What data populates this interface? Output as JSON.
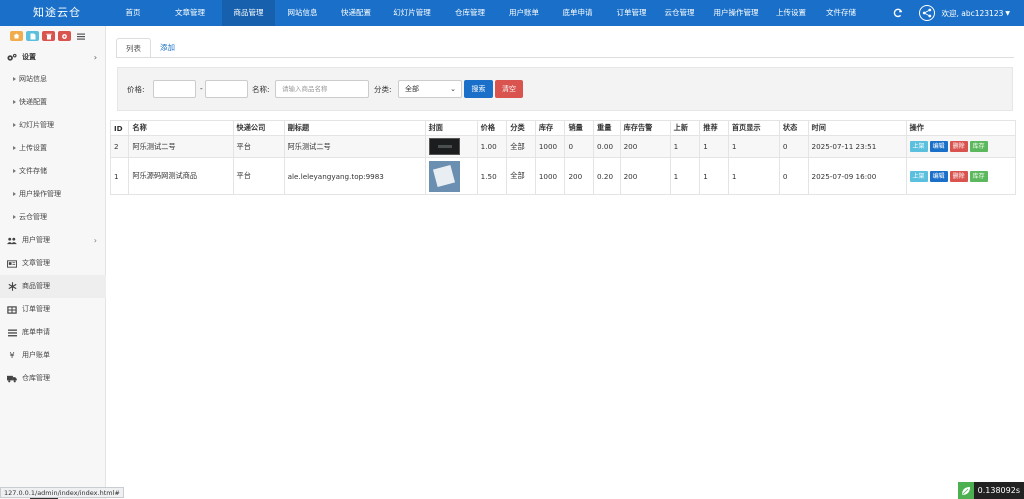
{
  "app": {
    "brand": "知途云仓"
  },
  "nav": {
    "items": [
      {
        "label": "首页"
      },
      {
        "label": "文章管理"
      },
      {
        "label": "商品管理"
      },
      {
        "label": "网站信息"
      },
      {
        "label": "快递配置"
      },
      {
        "label": "幻灯片管理"
      },
      {
        "label": "仓库管理"
      },
      {
        "label": "用户账单"
      },
      {
        "label": "底单申请"
      },
      {
        "label": "订单管理"
      },
      {
        "label": "云仓管理"
      },
      {
        "label": "用户操作管理"
      },
      {
        "label": "上传设置"
      },
      {
        "label": "文件存储"
      }
    ],
    "active_index": 2
  },
  "user": {
    "greeting": "欢迎, abc123123"
  },
  "sidebar": {
    "items": [
      {
        "label": "设置",
        "icon": "gears-icon"
      },
      {
        "label": "网站信息"
      },
      {
        "label": "快递配置"
      },
      {
        "label": "幻灯片管理"
      },
      {
        "label": "上传设置"
      },
      {
        "label": "文件存储"
      },
      {
        "label": "用户操作管理"
      },
      {
        "label": "云仓管理"
      },
      {
        "label": "用户管理",
        "icon": "users-icon"
      },
      {
        "label": "文章管理",
        "icon": "article-icon"
      },
      {
        "label": "商品管理",
        "icon": "snowflake-icon"
      },
      {
        "label": "订单管理",
        "icon": "order-icon"
      },
      {
        "label": "底单申请",
        "icon": "list-icon"
      },
      {
        "label": "用户账单",
        "icon": "yen-icon"
      },
      {
        "label": "仓库管理",
        "icon": "truck-icon"
      }
    ]
  },
  "tabs": [
    {
      "label": "列表"
    },
    {
      "label": "添加"
    }
  ],
  "filter": {
    "price_label": "价格:",
    "dash": "-",
    "name_label": "名称:",
    "name_placeholder": "请输入商品名称",
    "category_label": "分类:",
    "category_value": "全部",
    "search_label": "搜索",
    "clear_label": "清空"
  },
  "table": {
    "headers": [
      "ID",
      "名称",
      "快递公司",
      "副标题",
      "封面",
      "价格",
      "分类",
      "库存",
      "销量",
      "重量",
      "库存告警",
      "上新",
      "推荐",
      "首页显示",
      "状态",
      "时间",
      "操作"
    ],
    "rows": [
      {
        "id": "2",
        "name": "阿乐测试二号",
        "express": "平台",
        "subtitle": "阿乐测试二号",
        "price": "1.00",
        "category": "全部",
        "stock": "1000",
        "sales": "0",
        "weight": "0.00",
        "alert": "200",
        "new": "1",
        "recommend": "1",
        "home": "1",
        "status": "0",
        "time": "2025-07-11 23:51"
      },
      {
        "id": "1",
        "name": "阿乐源码网测试商品",
        "express": "平台",
        "subtitle": "ale.leleyangyang.top:9983",
        "price": "1.50",
        "category": "全部",
        "stock": "1000",
        "sales": "200",
        "weight": "0.20",
        "alert": "200",
        "new": "1",
        "recommend": "1",
        "home": "1",
        "status": "0",
        "time": "2025-07-09 16:00"
      }
    ],
    "ops": {
      "up": "上架",
      "edit": "编辑",
      "delete": "删除",
      "stock": "库存"
    }
  },
  "status_bar": {
    "url": "127.0.0.1/admin/index/index.html#",
    "timer": "0.138092s"
  }
}
